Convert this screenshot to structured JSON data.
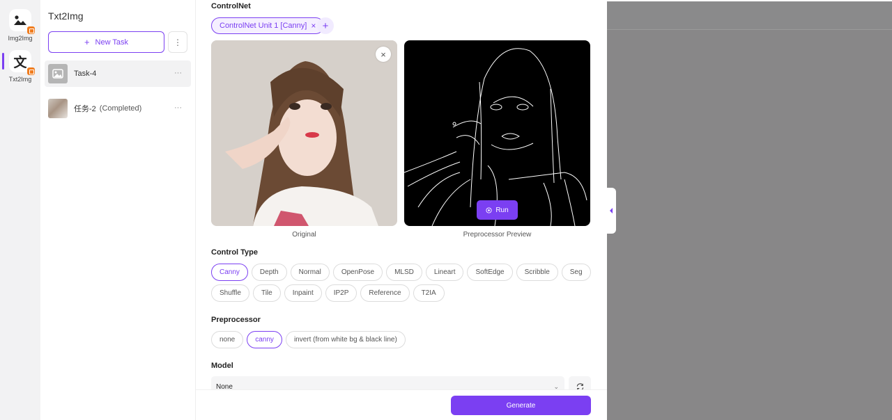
{
  "rail": {
    "items": [
      {
        "label": "Img2Img",
        "icon": "image-person-icon"
      },
      {
        "label": "Txt2Img",
        "icon": "translate-text-icon",
        "glyph": "文"
      }
    ],
    "active": "Txt2Img"
  },
  "tasks": {
    "title": "Txt2Img",
    "new_task_label": "New Task",
    "more_icon": "⋮",
    "items": [
      {
        "name": "Task-4",
        "status": "",
        "more": "···"
      },
      {
        "name": "任务-2",
        "status": "(Completed)",
        "more": "···"
      }
    ]
  },
  "controlnet": {
    "heading": "ControlNet",
    "unit_tab": "ControlNet Unit 1 [Canny]",
    "close_glyph": "×",
    "add_glyph": "+",
    "original_caption": "Original",
    "preview_caption": "Preprocessor Preview",
    "run_label": "Run"
  },
  "control_type": {
    "heading": "Control Type",
    "options": [
      "Canny",
      "Depth",
      "Normal",
      "OpenPose",
      "MLSD",
      "Lineart",
      "SoftEdge",
      "Scribble",
      "Seg",
      "Shuffle",
      "Tile",
      "Inpaint",
      "IP2P",
      "Reference",
      "T2IA"
    ],
    "selected": "Canny"
  },
  "preprocessor": {
    "heading": "Preprocessor",
    "options": [
      "none",
      "canny",
      "invert (from white bg & black line)"
    ],
    "selected": "canny"
  },
  "model": {
    "heading": "Model",
    "value": "None"
  },
  "footer": {
    "generate_label": "Generate"
  },
  "colors": {
    "accent": "#7b3ff2",
    "badge": "#f07c1e",
    "overlay": "#888788"
  }
}
